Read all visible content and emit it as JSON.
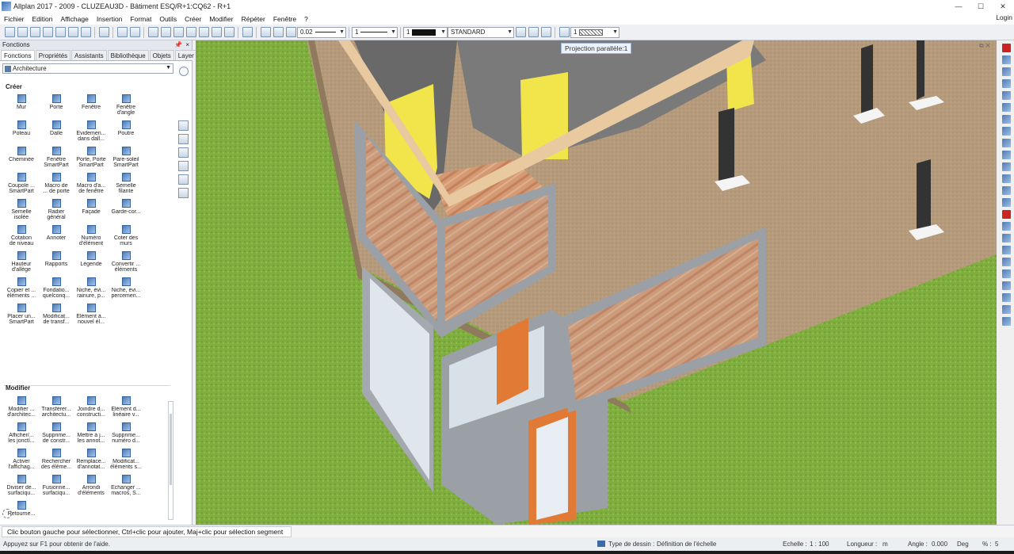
{
  "window": {
    "title": "Allplan 2017 - 2009 - CLUZEAU3D - Bâtiment ESQ/R+1:CQ62 - R+1",
    "controls": [
      "—",
      "☐",
      "✕"
    ]
  },
  "menu": {
    "items": [
      "Fichier",
      "Edition",
      "Affichage",
      "Insertion",
      "Format",
      "Outils",
      "Créer",
      "Modifier",
      "Répéter",
      "Fenêtre",
      "?"
    ],
    "login": "Login"
  },
  "toolbar": {
    "pen_thickness": "0.02",
    "line_type": "1",
    "color_index": "1",
    "layer": "STANDARD",
    "hatch": "1"
  },
  "panel": {
    "title": "Fonctions",
    "pin": "📌",
    "close": "×",
    "tabs": [
      "Fonctions",
      "Propriétés",
      "Assistants",
      "Bibliothèque",
      "Objets",
      "Layer"
    ],
    "active_tab": "Fonctions",
    "family": "Architecture",
    "create_title": "Créer",
    "create_items": [
      "Mur",
      "Porte",
      "Fenêtre",
      "Fenêtre\nd'angle",
      "Poteau",
      "Dalle",
      "Evidemen...\ndans dall...",
      "Poutre",
      "Cheminée",
      "Fenêtre\nSmartPart",
      "Porte, Porte\nSmartPart",
      "Pare-soleil\nSmartPart",
      "Coupole ...\nSmartPart",
      "Macro de\n... de porte",
      "Macro d'a...\nde fenêtre",
      "Semelle\nfilante",
      "Semelle\nisolée",
      "Radier\ngénéral",
      "Façade",
      "Garde-cor...",
      "Cotation\nde niveau",
      "Annoter",
      "Numéro\nd'élément",
      "Coter des\nmurs",
      "Hauteur\nd'allège",
      "Rapports",
      "Légende",
      "Convertir ...\néléments",
      "Copier et ...\néléments ...",
      "Fondatio...\nquelconq...",
      "Niche, évi...\nrainure, p...",
      "Niche, évi...\npercemen...",
      "Placer un...\nSmartPart",
      "Modificat...\nde transf...",
      "Élément à...\nnouvel él..."
    ],
    "modify_title": "Modifier",
    "modify_items": [
      "Modifier ...\nd'architec...",
      "Transférer...\narchitectu...",
      "Joindre d...\nconstructi...",
      "Élément d...\nlinéaire v...",
      "Afficher/...\nles jonctí...",
      "Supprime...\nde constr...",
      "Mettre à j...\nles annot...",
      "Supprime...\nnuméro d...",
      "Activer\nl'affichag...",
      "Rechercher\ndes éléme...",
      "Remplace...\nd'annotat...",
      "Modificat...\néléments s...",
      "Diviser de...\nsurfaciqu...",
      "Fusionne...\nsurfaciqu...",
      "Arrondi\nd'éléments",
      "Echanger ...\nmacros, S...",
      "Retourne..."
    ]
  },
  "viewport": {
    "tooltip": "Projection parallèle:1",
    "window_controls": "⧉ ✕"
  },
  "command_prompt": "Clic bouton gauche pour sélectionner, Ctrl+clic pour ajouter, Maj+clic pour sélection segment",
  "status": {
    "help": "Appuyez sur F1 pour obtenir de l'aide.",
    "drawing_type_label": "Type de dessin :",
    "drawing_type_value": "Définition de l'échelle",
    "scale_label": "Echelle :",
    "scale_value": "1 : 100",
    "length_label": "Longueur :",
    "length_value": "m",
    "angle_label": "Angle :",
    "angle_value": "0.000",
    "angle_unit": "Deg",
    "percent_label": "% :",
    "percent_value": "5"
  }
}
